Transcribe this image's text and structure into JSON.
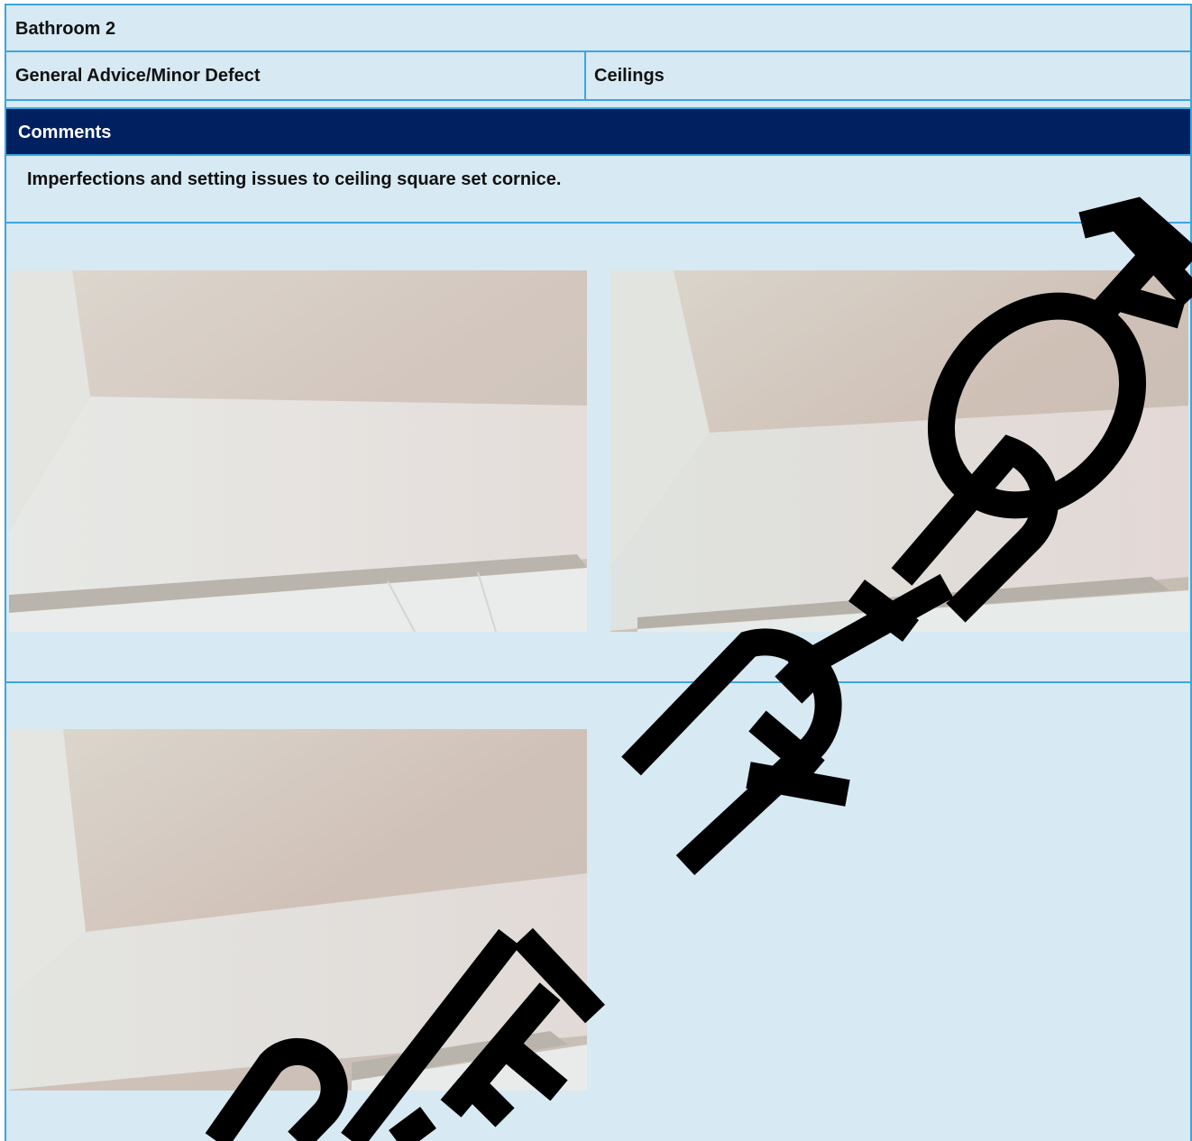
{
  "section": {
    "title": "Bathroom 2",
    "category": "General Advice/Minor Defect",
    "area": "Ceilings"
  },
  "comments": {
    "heading": "Comments",
    "text": "Imperfections and setting issues to ceiling square set cornice."
  },
  "photos": [
    {
      "label": "ceiling-photo-1"
    },
    {
      "label": "ceiling-photo-2"
    },
    {
      "label": "ceiling-photo-3"
    }
  ],
  "watermark": {
    "text": "SAMPLE REPORT",
    "color": "#000000"
  },
  "colors": {
    "panel": "#d7e9f2",
    "border": "#3ba6df",
    "header": "#002060"
  }
}
